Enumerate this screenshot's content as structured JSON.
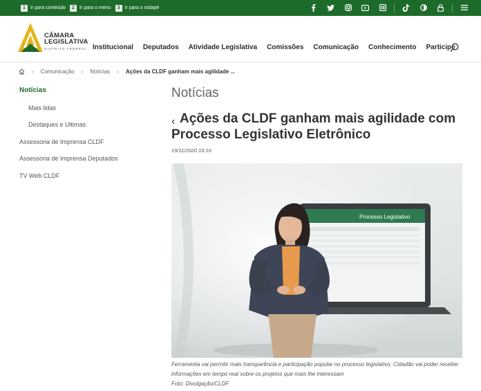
{
  "skip_links": [
    {
      "num": "1",
      "label": "Ir para conteúdo"
    },
    {
      "num": "2",
      "label": "Ir para o menu"
    },
    {
      "num": "3",
      "label": "Ir para o rodapé"
    }
  ],
  "top_icons": [
    "facebook-icon",
    "twitter-icon",
    "instagram-icon",
    "youtube-icon",
    "flickr-icon",
    "tiktok-icon",
    "contrast-icon",
    "lock-icon",
    "menu-icon"
  ],
  "logo": {
    "line1": "CÂMARA",
    "line2": "LEGISLATIVA",
    "line3": "DISTRITO FEDERAL"
  },
  "nav": [
    "Institucional",
    "Deputados",
    "Atividade Legislativa",
    "Comissões",
    "Comunicação",
    "Conhecimento",
    "Participe"
  ],
  "breadcrumb": {
    "c1": "Comunicação",
    "c2": "Notícias",
    "current": "Ações da CLDF ganham mais agilidade ..."
  },
  "sidebar": {
    "items": [
      {
        "label": "Notícias"
      },
      {
        "label": "Mais lidas"
      },
      {
        "label": "Destaques e Ultimas"
      },
      {
        "label": "Assessoria de Imprensa CLDF"
      },
      {
        "label": "Assessoria de Imprensa Deputados"
      },
      {
        "label": "TV Web CLDF"
      }
    ]
  },
  "main": {
    "section_title": "Notícias",
    "headline": "Ações da CLDF ganham mais agilidade com Processo Legislativo Eletrônico",
    "date": "19/11/2020 16:10",
    "caption_1": "Ferramenta vai permitir mais transparência e participação popular no processo legislativo. Cidadão vai poder receber informações em tempo real sobre os projetos que mais lhe interessam",
    "caption_2": "Foto: Divulgação/CLDF",
    "screen_title": "Processo Legislativo"
  },
  "colors": {
    "brand": "#1d6b2a",
    "logo_gold": "#e5b21a"
  }
}
